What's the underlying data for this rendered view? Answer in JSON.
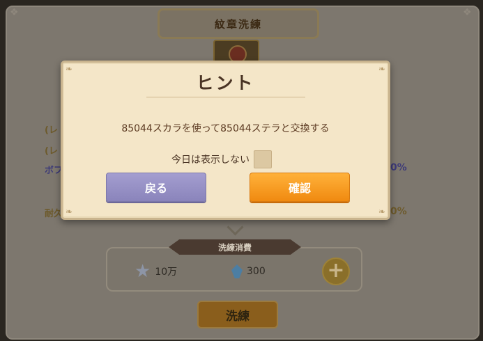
{
  "background": {
    "title": "紋章洗練",
    "left_labels": [
      "(レ",
      "(レ",
      "ボフ",
      "耐久"
    ],
    "right_percents": [
      "0%",
      "0%"
    ],
    "cost": {
      "label": "洗練消費",
      "items": [
        {
          "icon": "star-icon",
          "amount": "10万"
        },
        {
          "icon": "crystal-icon",
          "amount": "300"
        }
      ],
      "plus_symbol": "+"
    },
    "refine_button": "洗練"
  },
  "dialog": {
    "title": "ヒント",
    "message": "85044スカラを使って85044ステラと交換する",
    "checkbox_label": "今日は表示しない",
    "back_button": "戻る",
    "confirm_button": "確認"
  },
  "colors": {
    "confirm": "#f59a1c",
    "back": "#9a94c8",
    "dialog_bg": "#f4e6c8"
  }
}
